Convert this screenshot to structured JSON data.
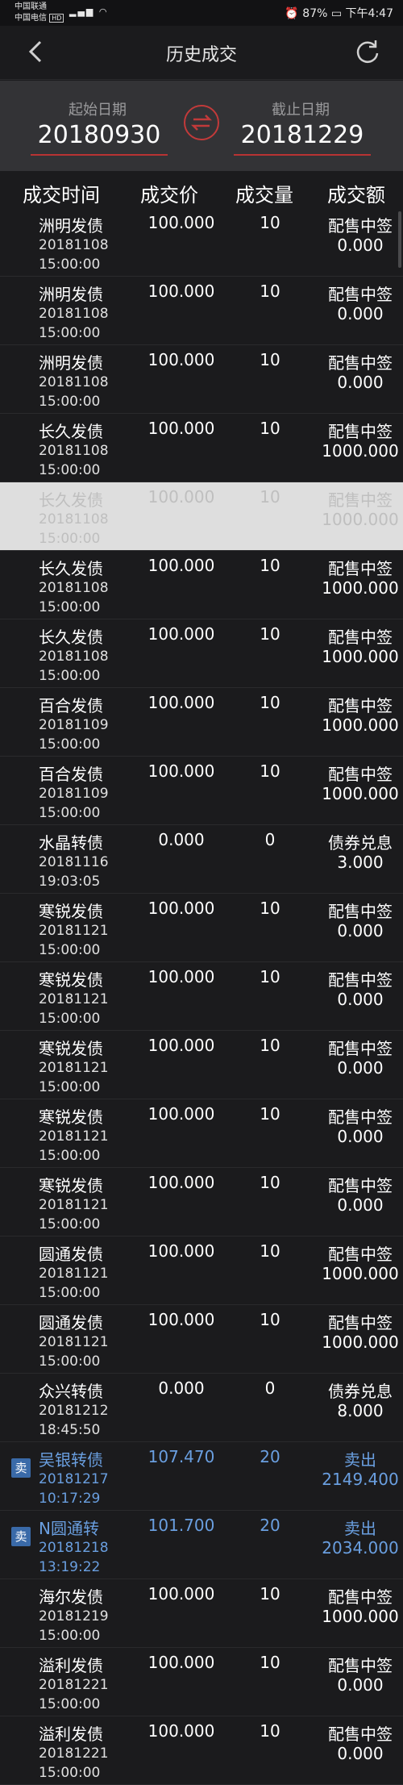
{
  "status": {
    "carrier1": "中国联通",
    "carrier2": "中国电信",
    "hd": "HD",
    "battery": "87%",
    "time": "下午4:47"
  },
  "nav": {
    "title": "历史成交"
  },
  "dates": {
    "start_label": "起始日期",
    "start_value": "20180930",
    "end_label": "截止日期",
    "end_value": "20181229"
  },
  "columns": {
    "time": "成交时间",
    "price": "成交价",
    "qty": "成交量",
    "amount": "成交额"
  },
  "rows": [
    {
      "name": "洲明发债",
      "date": "20181108",
      "time": "15:00:00",
      "price": "100.000",
      "qty": "10",
      "kind": "配售中签",
      "amount": "0.000"
    },
    {
      "name": "洲明发债",
      "date": "20181108",
      "time": "15:00:00",
      "price": "100.000",
      "qty": "10",
      "kind": "配售中签",
      "amount": "0.000"
    },
    {
      "name": "洲明发债",
      "date": "20181108",
      "time": "15:00:00",
      "price": "100.000",
      "qty": "10",
      "kind": "配售中签",
      "amount": "0.000"
    },
    {
      "name": "长久发债",
      "date": "20181108",
      "time": "15:00:00",
      "price": "100.000",
      "qty": "10",
      "kind": "配售中签",
      "amount": "1000.000"
    },
    {
      "name": "长久发债",
      "date": "20181108",
      "time": "15:00:00",
      "price": "100.000",
      "qty": "10",
      "kind": "配售中签",
      "amount": "1000.000"
    },
    {
      "name": "长久发债",
      "date": "20181108",
      "time": "15:00:00",
      "price": "100.000",
      "qty": "10",
      "kind": "配售中签",
      "amount": "1000.000"
    },
    {
      "name": "长久发债",
      "date": "20181108",
      "time": "15:00:00",
      "price": "100.000",
      "qty": "10",
      "kind": "配售中签",
      "amount": "1000.000"
    },
    {
      "name": "百合发债",
      "date": "20181109",
      "time": "15:00:00",
      "price": "100.000",
      "qty": "10",
      "kind": "配售中签",
      "amount": "1000.000"
    },
    {
      "name": "百合发债",
      "date": "20181109",
      "time": "15:00:00",
      "price": "100.000",
      "qty": "10",
      "kind": "配售中签",
      "amount": "1000.000"
    },
    {
      "name": "水晶转债",
      "date": "20181116",
      "time": "19:03:05",
      "price": "0.000",
      "qty": "0",
      "kind": "债券兑息",
      "amount": "3.000"
    },
    {
      "name": "寒锐发债",
      "date": "20181121",
      "time": "15:00:00",
      "price": "100.000",
      "qty": "10",
      "kind": "配售中签",
      "amount": "0.000"
    },
    {
      "name": "寒锐发债",
      "date": "20181121",
      "time": "15:00:00",
      "price": "100.000",
      "qty": "10",
      "kind": "配售中签",
      "amount": "0.000"
    },
    {
      "name": "寒锐发债",
      "date": "20181121",
      "time": "15:00:00",
      "price": "100.000",
      "qty": "10",
      "kind": "配售中签",
      "amount": "0.000"
    },
    {
      "name": "寒锐发债",
      "date": "20181121",
      "time": "15:00:00",
      "price": "100.000",
      "qty": "10",
      "kind": "配售中签",
      "amount": "0.000"
    },
    {
      "name": "寒锐发债",
      "date": "20181121",
      "time": "15:00:00",
      "price": "100.000",
      "qty": "10",
      "kind": "配售中签",
      "amount": "0.000"
    },
    {
      "name": "圆通发债",
      "date": "20181121",
      "time": "15:00:00",
      "price": "100.000",
      "qty": "10",
      "kind": "配售中签",
      "amount": "1000.000"
    },
    {
      "name": "圆通发债",
      "date": "20181121",
      "time": "15:00:00",
      "price": "100.000",
      "qty": "10",
      "kind": "配售中签",
      "amount": "1000.000"
    },
    {
      "name": "众兴转债",
      "date": "20181212",
      "time": "18:45:50",
      "price": "0.000",
      "qty": "0",
      "kind": "债券兑息",
      "amount": "8.000"
    },
    {
      "name": "吴银转债",
      "date": "20181217",
      "time": "10:17:29",
      "price": "107.470",
      "qty": "20",
      "kind": "卖出",
      "amount": "2149.400",
      "badge": "卖"
    },
    {
      "name": "N圆通转",
      "date": "20181218",
      "time": "13:19:22",
      "price": "101.700",
      "qty": "20",
      "kind": "卖出",
      "amount": "2034.000",
      "badge": "卖"
    },
    {
      "name": "海尔发债",
      "date": "20181219",
      "time": "15:00:00",
      "price": "100.000",
      "qty": "10",
      "kind": "配售中签",
      "amount": "1000.000"
    },
    {
      "name": "溢利发债",
      "date": "20181221",
      "time": "15:00:00",
      "price": "100.000",
      "qty": "10",
      "kind": "配售中签",
      "amount": "0.000"
    },
    {
      "name": "溢利发债",
      "date": "20181221",
      "time": "15:00:00",
      "price": "100.000",
      "qty": "10",
      "kind": "配售中签",
      "amount": "0.000"
    }
  ],
  "colors": {
    "accent_red": "#c23a3a",
    "sell_blue": "#6a9fe0",
    "background": "#1b1b1d"
  }
}
